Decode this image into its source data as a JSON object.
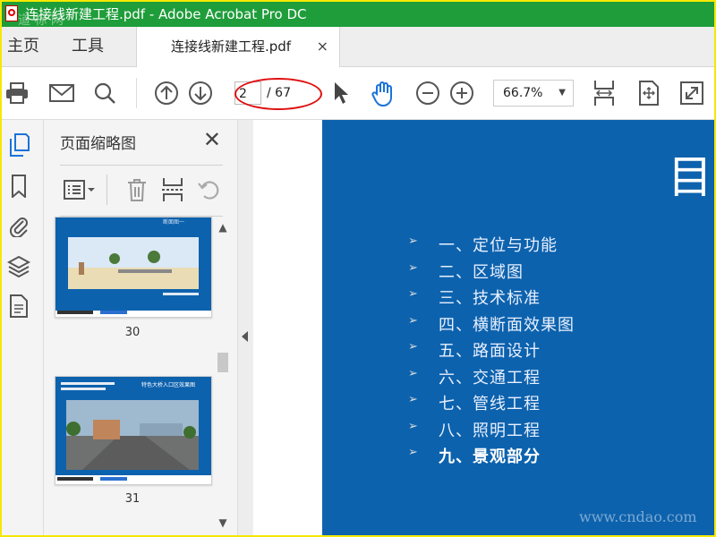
{
  "window": {
    "title": "连接线新建工程.pdf - Adobe Acrobat Pro DC",
    "watermark": "道 标 网"
  },
  "tabs": {
    "home": "主页",
    "tools": "工具",
    "document": "连接线新建工程.pdf",
    "close": "×"
  },
  "toolbar": {
    "current_page": "2",
    "total_pages": "/ 67",
    "zoom": "66.7%"
  },
  "panel": {
    "title": "页面缩略图",
    "thumbnails": [
      {
        "number": "30",
        "caption": "断面图一"
      },
      {
        "number": "31",
        "caption": "特色大桥入口区效果图"
      }
    ]
  },
  "slide": {
    "heading_char": "目",
    "toc": [
      "一、定位与功能",
      "二、区域图",
      "三、技术标准",
      "四、横断面效果图",
      "五、路面设计",
      "六、交通工程",
      "七、管线工程",
      "八、照明工程",
      "九、景观部分"
    ],
    "watermark": "www.cndao.com"
  },
  "colors": {
    "titlebar": "#1f9d3a",
    "slide_bg": "#0d62ad",
    "accent_blue": "#1a73d9",
    "highlight_red": "#e01010"
  }
}
